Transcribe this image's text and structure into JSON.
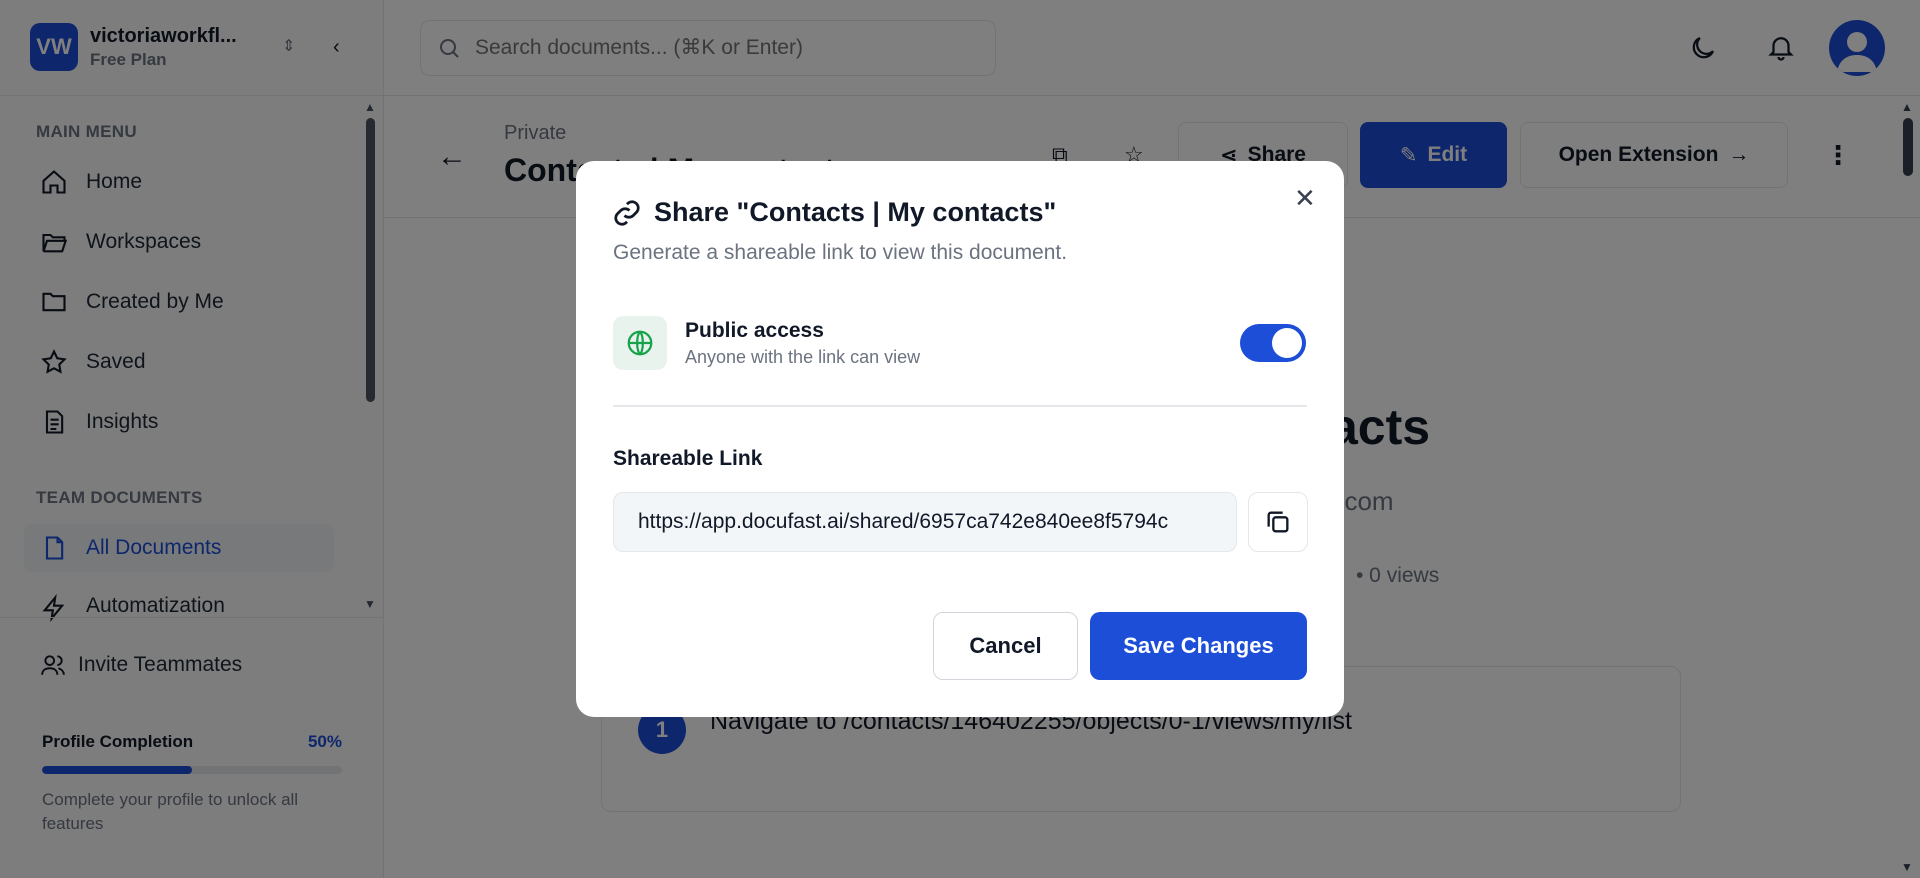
{
  "workspace": {
    "initials": "VW",
    "name": "victoriaworkfl...",
    "plan": "Free Plan"
  },
  "search": {
    "placeholder": "Search documents... (⌘K or Enter)"
  },
  "sidebar": {
    "main_menu_title": "MAIN MENU",
    "items": [
      {
        "label": "Home",
        "icon": "home-icon"
      },
      {
        "label": "Workspaces",
        "icon": "folder-open-icon"
      },
      {
        "label": "Created by Me",
        "icon": "folder-icon"
      },
      {
        "label": "Saved",
        "icon": "star-icon"
      },
      {
        "label": "Insights",
        "icon": "document-icon"
      }
    ],
    "team_title": "TEAM DOCUMENTS",
    "team_items": [
      {
        "label": "All Documents",
        "icon": "file-icon",
        "active": true
      },
      {
        "label": "Automatization",
        "icon": "lightning-icon"
      }
    ],
    "invite_label": "Invite Teammates",
    "profile": {
      "title": "Profile Completion",
      "percent_label": "50%",
      "percent": 50,
      "description": "Complete your profile to unlock all features"
    }
  },
  "doc": {
    "breadcrumb": "Private",
    "title": "Contacts | My contacts",
    "share_label": "Share",
    "edit_label": "Edit",
    "extension_label": "Open Extension",
    "main_title": "acts",
    "main_sub": "t.com",
    "views": "•   0 views",
    "step_number": "1",
    "step_text": "Navigate to /contacts/146402255/objects/0-1/views/my/list"
  },
  "modal": {
    "title": "Share \"Contacts | My contacts\"",
    "description": "Generate a shareable link to view this document.",
    "public_title": "Public access",
    "public_sub": "Anyone with the link can view",
    "public_enabled": true,
    "link_label": "Shareable Link",
    "link_value": "https://app.docufast.ai/shared/6957ca742e840ee8f5794c",
    "cancel_label": "Cancel",
    "save_label": "Save Changes"
  },
  "colors": {
    "accent": "#1d4ed8",
    "globe": "#16a34a"
  }
}
